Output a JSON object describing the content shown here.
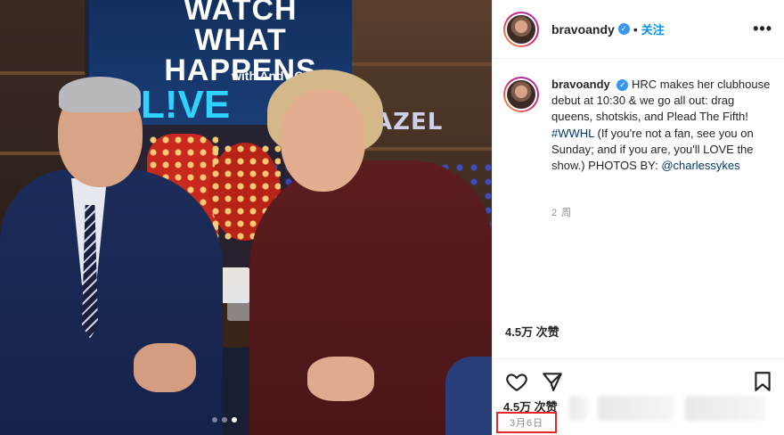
{
  "photo": {
    "show_logo": {
      "line1": "WATCH",
      "line2": "WHAT",
      "line3": "HAPPENS",
      "line4": "L!VE",
      "line5": "with",
      "line6": "Andy Cohen"
    },
    "background_sign": "AZEL",
    "carousel": {
      "count": 3,
      "active_index": 2
    }
  },
  "header": {
    "username": "bravoandy",
    "verified_icon": "verified-badge-icon",
    "separator": "•",
    "follow_label": "关注",
    "more_label": "•••"
  },
  "caption": {
    "username": "bravoandy",
    "text_part1": "HRC makes her clubhouse debut at 10:30 & we go all out: drag queens, shotskis, and Plead The Fifth! ",
    "hashtag": "#WWHL",
    "text_part2": " (If you're not a fan, see you on Sunday; and if you are, you'll LOVE the show.) PHOTOS BY: ",
    "mention": "@charlessykes",
    "age": "2 周"
  },
  "stats": {
    "likes_partial": "4.5万 次赞",
    "likes": "4.5万 次赞",
    "date": "3月6日"
  },
  "icons": {
    "like": "heart-icon",
    "share": "paper-plane-icon",
    "save": "bookmark-icon"
  },
  "colors": {
    "link": "#0095f6",
    "verified": "#3897f0",
    "date_highlight": "#e8262a",
    "hashtag": "#00376b"
  }
}
